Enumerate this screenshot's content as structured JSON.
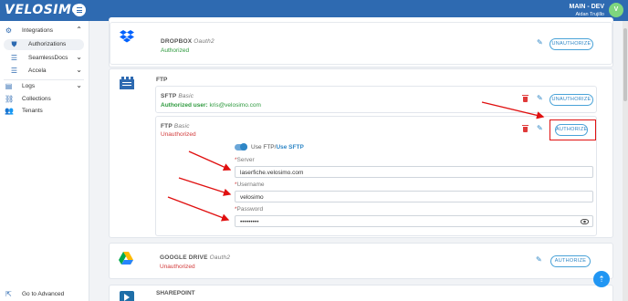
{
  "header": {
    "logo": "VELOSIMO",
    "env": "MAIN - DEV",
    "user": "Aidan Trujillo",
    "avatar_initial": "V"
  },
  "sidebar": {
    "integrations": "Integrations",
    "authorizations": "Authorizations",
    "seamlessdocs": "SeamlessDocs",
    "accela": "Accela",
    "logs": "Logs",
    "collections": "Collections",
    "tenants": "Tenants",
    "go_advanced": "Go to Advanced"
  },
  "dropbox": {
    "name": "DROPBOX",
    "auth_type": "Oauth2",
    "status": "Authorized",
    "button": "UNAUTHORIZE"
  },
  "ftp_section": {
    "label": "FTP",
    "sftp": {
      "name": "SFTP",
      "auth_type": "Basic",
      "status_prefix": "Authorized user:",
      "status_user": "kris@velosimo.com",
      "button": "UNAUTHORIZE"
    },
    "ftp": {
      "name": "FTP",
      "auth_type": "Basic",
      "status": "Unauthorized",
      "button": "AUTHORIZE",
      "toggle_label": "Use FTP/",
      "toggle_label_active": "Use SFTP",
      "server_label": "Server",
      "server_value": "laserfiche.velosimo.com",
      "username_label": "Username",
      "username_value": "velosimo",
      "password_label": "Password",
      "password_value": "•••••••••"
    }
  },
  "google_drive": {
    "name": "GOOGLE DRIVE",
    "auth_type": "Oauth2",
    "status": "Unauthorized",
    "button": "AUTHORIZE"
  },
  "sharepoint": {
    "label": "SHAREPOINT"
  },
  "colors": {
    "brand": "#2e6ab1",
    "accent": "#2e86c6",
    "success": "#2e9a3e",
    "danger": "#d23a3a",
    "annotation": "#e01010"
  },
  "icons": [
    "menu-icon",
    "gear-icon",
    "shield-icon",
    "seamlessdocs-icon",
    "accela-icon",
    "logs-icon",
    "collections-icon",
    "tenants-icon",
    "external-link-icon",
    "dropbox-icon",
    "ftp-icon",
    "google-drive-icon",
    "sharepoint-icon",
    "pencil-icon",
    "trash-icon",
    "eye-icon",
    "scroll-top-icon"
  ]
}
